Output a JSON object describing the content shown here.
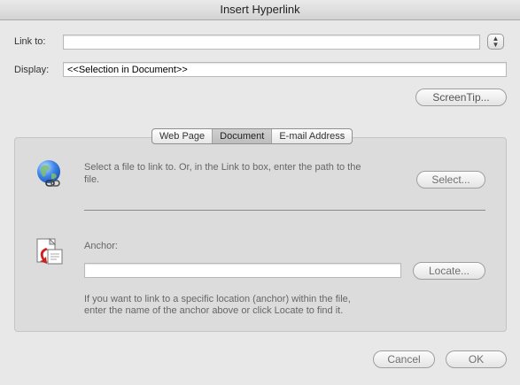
{
  "window": {
    "title": "Insert Hyperlink"
  },
  "form": {
    "link_to_label": "Link to:",
    "link_to_value": "",
    "display_label": "Display:",
    "display_value": "<<Selection in Document>>"
  },
  "buttons": {
    "screentip": "ScreenTip...",
    "select": "Select...",
    "locate": "Locate...",
    "cancel": "Cancel",
    "ok": "OK"
  },
  "tabs": [
    {
      "label": "Web Page",
      "selected": false
    },
    {
      "label": "Document",
      "selected": true
    },
    {
      "label": "E-mail Address",
      "selected": false
    }
  ],
  "document_tab": {
    "select_desc_line1": "Select a file to link to. Or, in the Link to box, enter the path to the",
    "select_desc_line2": "file.",
    "anchor_label": "Anchor:",
    "anchor_value": "",
    "anchor_help_line1": "If you want to link to a specific location (anchor) within the file,",
    "anchor_help_line2": "enter the name of the anchor above or click Locate to find it."
  },
  "icons": {
    "globe": "globe-link-icon",
    "anchor": "anchor-document-icon",
    "stepper": "stepper-icon"
  },
  "colors": {
    "window_bg": "#e8e8e8",
    "panel_bg": "#dcdcdc",
    "globe_blue": "#2f6fd6",
    "anchor_red": "#cc1f1f"
  }
}
